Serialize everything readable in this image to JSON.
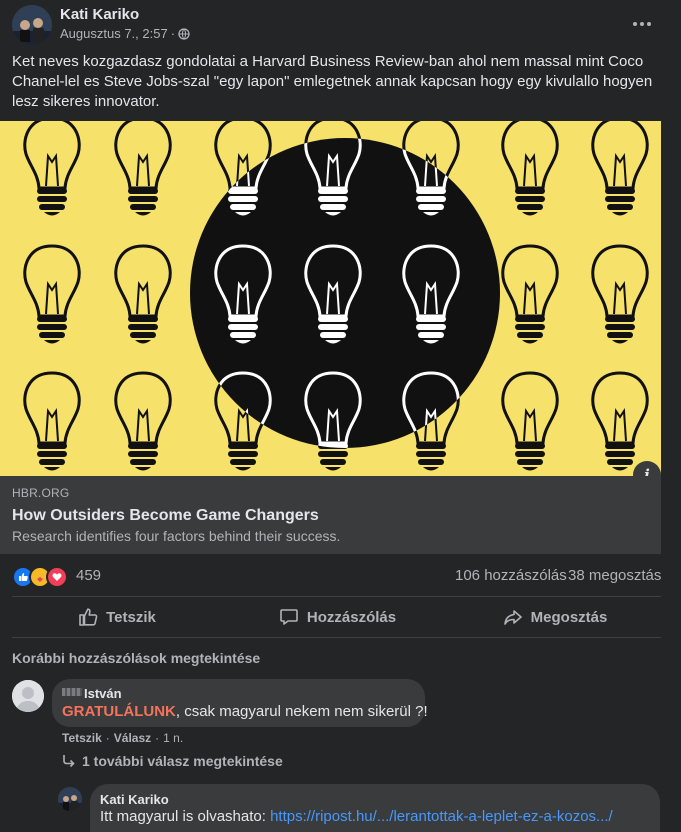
{
  "post": {
    "author": "Kati Kariko",
    "time": "Augusztus 7., 2:57",
    "dot": "·",
    "text": "Ket neves kozgazdasz gondolatai a Harvard Business Review-ban ahol nem massal mint Coco Chanel-lel es Steve Jobs-szal  \"egy lapon\" emlegetnek annak kapcsan hogy egy kivulallo hogyen lesz sikeres innovator."
  },
  "link": {
    "domain": "HBR.ORG",
    "title": "How Outsiders Become Game Changers",
    "description": "Research identifies four factors behind their success.",
    "info": "i"
  },
  "stats": {
    "reactions": "459",
    "comments": "106 hozzászólás",
    "shares": "38 megosztás"
  },
  "actions": {
    "like": "Tetszik",
    "comment": "Hozzászólás",
    "share": "Megosztás"
  },
  "comments": {
    "view_previous": "Korábbi hozzászólások megtekintése",
    "first": {
      "author": "István",
      "highlight": "GRATULÁLUNK",
      "text": ", csak magyarul nekem nem sikerül ?!",
      "like": "Tetszik",
      "reply": "Válasz",
      "time": "1 n."
    },
    "more_replies": "1 további válasz megtekintése",
    "reply": {
      "author": "Kati Kariko",
      "text": "Itt magyarul is olvashato: ",
      "link": "https://ripost.hu/.../lerantottak-a-leplet-ez-a-kozos.../"
    }
  },
  "colors": {
    "background": "#242526",
    "bubble": "#3a3b3c",
    "image_yellow": "#f6e16a",
    "highlight": "#f3735b",
    "link": "#4599ff"
  }
}
